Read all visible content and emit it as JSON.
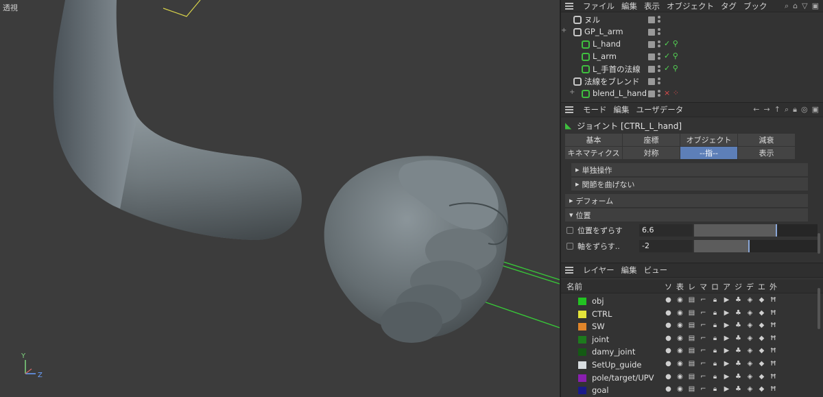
{
  "viewport": {
    "label": "透視",
    "axis_y": "Y",
    "axis_z": "Z"
  },
  "object_manager": {
    "menu": [
      "ファイル",
      "編集",
      "表示",
      "オブジェクト",
      "タグ",
      "ブック"
    ],
    "objects": [
      {
        "name": "ヌル",
        "indent": 0,
        "icon_color": "#c8c8c8",
        "tag": "",
        "expander": ""
      },
      {
        "name": "GP_L_arm",
        "indent": 0,
        "icon_color": "#c8c8c8",
        "tag": "",
        "expander": "+"
      },
      {
        "name": "L_hand",
        "indent": 1,
        "icon_color": "#3fbf3f",
        "tag": "✓ ⚲",
        "expander": ""
      },
      {
        "name": "L_arm",
        "indent": 1,
        "icon_color": "#3fbf3f",
        "tag": "✓ ⚲",
        "expander": ""
      },
      {
        "name": "L_手首の法線",
        "indent": 1,
        "icon_color": "#3fbf3f",
        "tag": "✓ ⚲",
        "expander": ""
      },
      {
        "name": "法線をブレンド",
        "indent": 0,
        "icon_color": "#c8c8c8",
        "tag": "",
        "expander": ""
      },
      {
        "name": "blend_L_hand",
        "indent": 1,
        "icon_color": "#3fbf3f",
        "tag": "× ⁘",
        "expander": "+"
      }
    ]
  },
  "attribute_manager": {
    "menu": [
      "モード",
      "編集",
      "ユーザデータ"
    ],
    "title": "ジョイント [CTRL_L_hand]",
    "tabs_row1": [
      "基本",
      "座標",
      "オブジェクト",
      "減衰"
    ],
    "tabs_row2": [
      "キネマティクス",
      "対称",
      "--指--",
      "表示"
    ],
    "active_tab": "--指--",
    "groups_collapsed": [
      "単独操作",
      "関節を曲げない"
    ],
    "group_deform": "デフォーム",
    "group_position": "位置",
    "params": [
      {
        "label": "位置をずらす",
        "value": "6.6",
        "fill": 0.66
      },
      {
        "label": "軸をずらす..",
        "value": "-2",
        "fill": 0.44
      }
    ]
  },
  "layer_manager": {
    "menu": [
      "レイヤー",
      "編集",
      "ビュー"
    ],
    "header_name": "名前",
    "header_flags": [
      "ソ",
      "表",
      "レ",
      "マ",
      "ロ",
      "ア",
      "ジ",
      "デ",
      "エ",
      "外"
    ],
    "layers": [
      {
        "name": "obj",
        "color": "#22c322"
      },
      {
        "name": "CTRL",
        "color": "#e4e43a"
      },
      {
        "name": "SW",
        "color": "#e0852a"
      },
      {
        "name": "joint",
        "color": "#1d7a1d"
      },
      {
        "name": "damy_joint",
        "color": "#145a14"
      },
      {
        "name": "SetUp_guide",
        "color": "#d8dde0"
      },
      {
        "name": "pole/target/UPV",
        "color": "#8a1fb0"
      },
      {
        "name": "goal",
        "color": "#1a1a8a"
      }
    ]
  }
}
